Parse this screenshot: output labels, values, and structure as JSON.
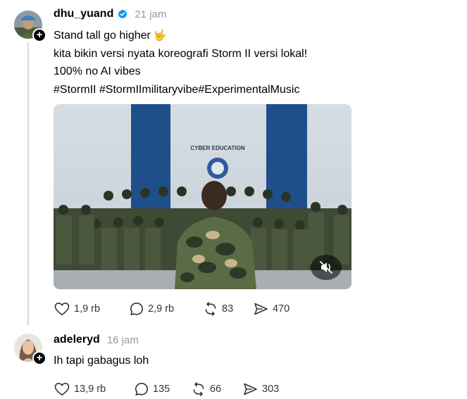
{
  "post": {
    "username": "dhu_yuand",
    "verified": true,
    "time": "21 jam",
    "lines": [
      "Stand tall go higher",
      "kita bikin versi nyata koreografi Storm II versi lokal!",
      "100% no AI vibes",
      "#StormII #StormIImilitaryvibe#ExperimentalMusic"
    ],
    "emoji": "🤟",
    "media": {
      "sign_text": "CYBER EDUCATION"
    },
    "actions": {
      "likes": "1,9 rb",
      "comments": "2,9 rb",
      "reposts": "83",
      "shares": "470"
    }
  },
  "reply": {
    "username": "adeleryd",
    "time": "16 jam",
    "text": "Ih tapi gabagus loh",
    "actions": {
      "likes": "13,9 rb",
      "comments": "135",
      "reposts": "66",
      "shares": "303"
    }
  },
  "colors": {
    "verified": "#0095f6",
    "muted_text": "#999999",
    "thread_line": "#d9d9d9"
  },
  "icons": [
    "heart-icon",
    "comment-icon",
    "repost-icon",
    "share-icon",
    "mute-icon",
    "verified-icon",
    "plus-icon"
  ]
}
